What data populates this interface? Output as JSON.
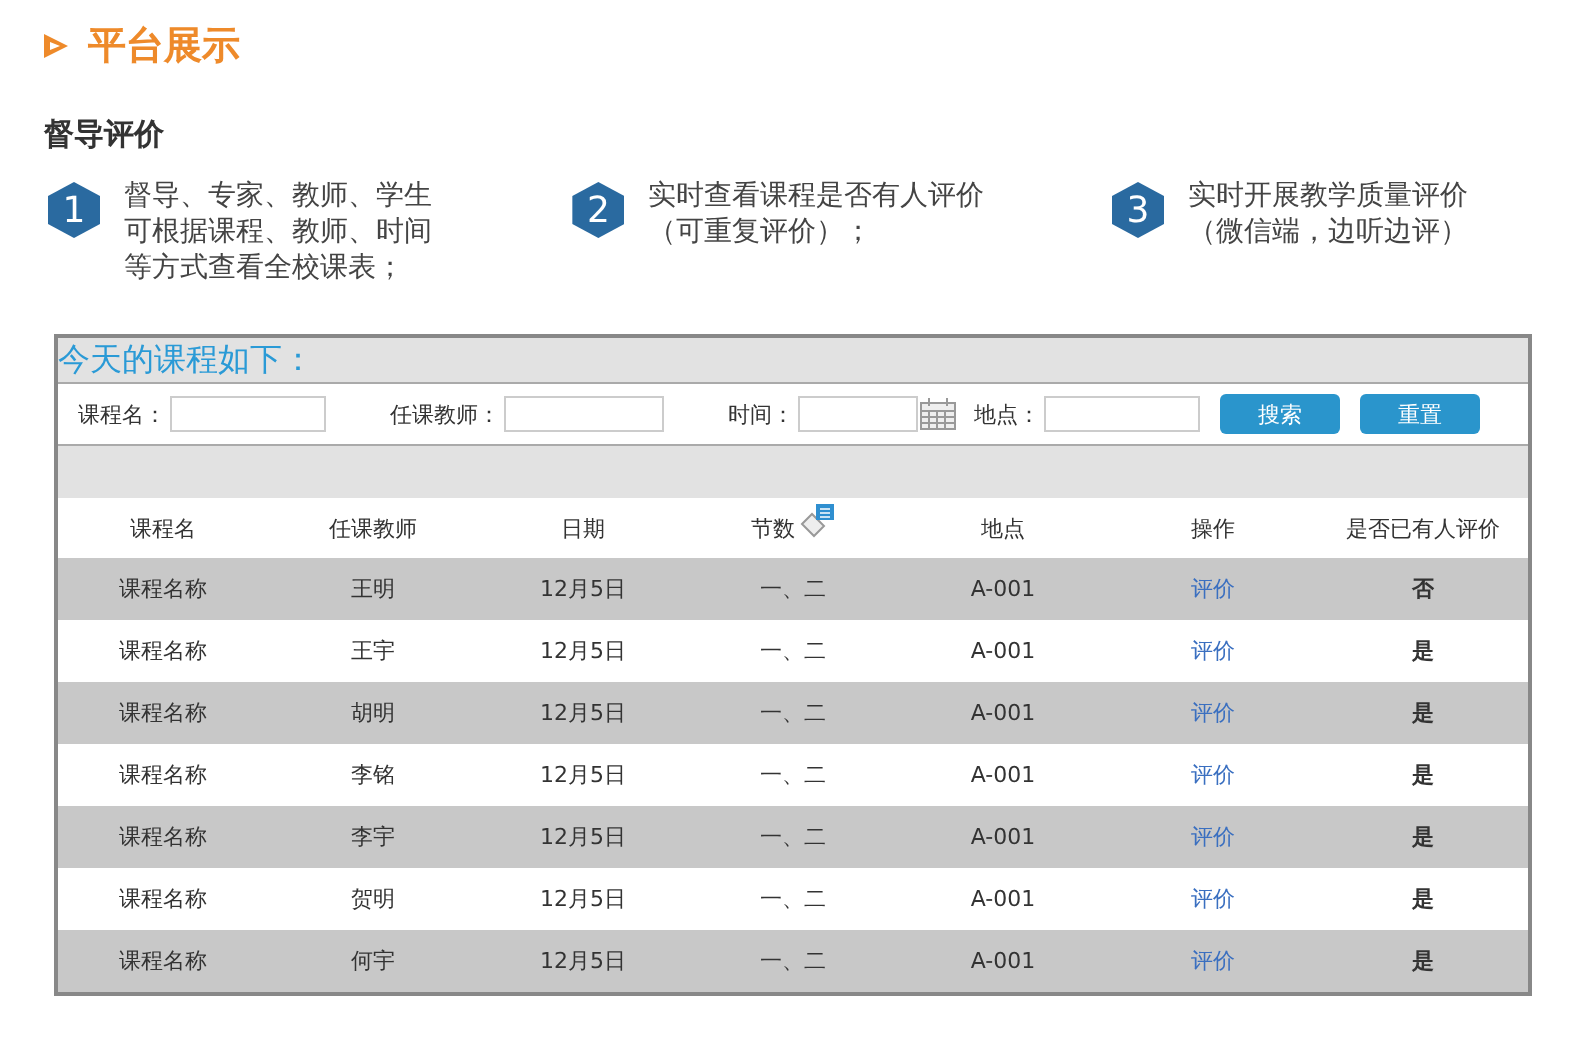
{
  "heading": "平台展示",
  "subheading": "督导评价",
  "steps": [
    {
      "number": "1",
      "lines": [
        "督导、专家、教师、学生",
        "可根据课程、教师、时间",
        "等方式查看全校课表；"
      ]
    },
    {
      "number": "2",
      "lines": [
        "实时查看课程是否有人评价",
        "（可重复评价）；"
      ]
    },
    {
      "number": "3",
      "lines": [
        "实时开展教学质量评价",
        "（微信端，边听边评）"
      ]
    }
  ],
  "window": {
    "title": "今天的课程如下："
  },
  "filters": [
    {
      "label": "课程名：",
      "kind": "text"
    },
    {
      "label": "任课教师：",
      "kind": "text"
    },
    {
      "label": "时间：",
      "kind": "date"
    },
    {
      "label": "地点：",
      "kind": "text"
    }
  ],
  "buttons": [
    "搜索",
    "重置"
  ],
  "table": {
    "columns": [
      {
        "label": "课程名",
        "kind": "text"
      },
      {
        "label": "任课教师",
        "kind": "text"
      },
      {
        "label": "日期",
        "kind": "text"
      },
      {
        "label": "节数",
        "kind": "note"
      },
      {
        "label": "地点",
        "kind": "text"
      },
      {
        "label": "操作",
        "kind": "link"
      },
      {
        "label": "是否已有人评价",
        "kind": "bold"
      }
    ],
    "rows": [
      [
        "课程名称",
        "王明",
        "12月5日",
        "一、二",
        "A-001",
        "评价",
        "否"
      ],
      [
        "课程名称",
        "王宇",
        "12月5日",
        "一、二",
        "A-001",
        "评价",
        "是"
      ],
      [
        "课程名称",
        "胡明",
        "12月5日",
        "一、二",
        "A-001",
        "评价",
        "是"
      ],
      [
        "课程名称",
        "李铭",
        "12月5日",
        "一、二",
        "A-001",
        "评价",
        "是"
      ],
      [
        "课程名称",
        "李宇",
        "12月5日",
        "一、二",
        "A-001",
        "评价",
        "是"
      ],
      [
        "课程名称",
        "贺明",
        "12月5日",
        "一、二",
        "A-001",
        "评价",
        "是"
      ],
      [
        "课程名称",
        "何宇",
        "12月5日",
        "一、二",
        "A-001",
        "评价",
        "是"
      ]
    ]
  }
}
